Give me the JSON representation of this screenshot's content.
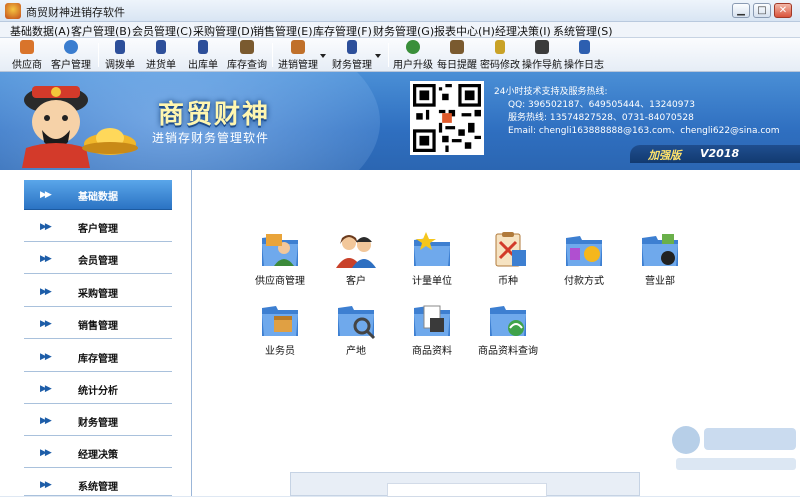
{
  "window": {
    "title": "商贸财神进销存软件",
    "minimize": "▁",
    "maximize": "□",
    "close": "✕"
  },
  "menu": [
    "基础数据(A)",
    "客户管理(B)",
    "会员管理(C)",
    "采购管理(D)",
    "销售管理(E)",
    "库存管理(F)",
    "财务管理(G)",
    "报表中心(H)",
    "经理决策(I)",
    "系统管理(S)"
  ],
  "toolbar": [
    {
      "label": "供应商",
      "icon": "supplier-icon",
      "color": "#d9742b"
    },
    {
      "label": "客户管理",
      "icon": "customer-icon",
      "color": "#3a7dcf"
    },
    {
      "label": "调拨单",
      "icon": "transfer-doc-icon",
      "color": "#2d4f9a"
    },
    {
      "label": "进货单",
      "icon": "purchase-doc-icon",
      "color": "#2d4f9a"
    },
    {
      "label": "出库单",
      "icon": "outbound-doc-icon",
      "color": "#2d4f9a"
    },
    {
      "label": "库存查询",
      "icon": "inventory-query-icon",
      "color": "#7a5a2f"
    },
    {
      "label": "进销管理",
      "icon": "sales-purchase-icon",
      "color": "#c0702a"
    },
    {
      "label": "财务管理",
      "icon": "finance-icon",
      "color": "#2d4f9a"
    },
    {
      "label": "用户升级",
      "icon": "upgrade-icon",
      "color": "#3a8f3a"
    },
    {
      "label": "每日提醒",
      "icon": "reminder-icon",
      "color": "#7a5a2f"
    },
    {
      "label": "密码修改",
      "icon": "password-icon",
      "color": "#c9a227"
    },
    {
      "label": "操作导航",
      "icon": "navigation-icon",
      "color": "#3b3b3b"
    },
    {
      "label": "操作日志",
      "icon": "log-icon",
      "color": "#2d5fb0"
    }
  ],
  "banner": {
    "brand_title": "商贸财神",
    "brand_subtitle": "进销存财务管理软件",
    "support": [
      "24小时技术支持及服务热线:",
      "QQ: 396502187、649505444、13240973",
      "服务热线: 13574827528、0731-84070528",
      "Email: chengli163888888@163.com、chengli622@sina.com"
    ],
    "edition_label": "加强版",
    "edition_version": "V2018"
  },
  "sidebar": [
    {
      "label": "基础数据",
      "active": true
    },
    {
      "label": "客户管理",
      "active": false
    },
    {
      "label": "会员管理",
      "active": false
    },
    {
      "label": "采购管理",
      "active": false
    },
    {
      "label": "销售管理",
      "active": false
    },
    {
      "label": "库存管理",
      "active": false
    },
    {
      "label": "统计分析",
      "active": false
    },
    {
      "label": "财务管理",
      "active": false
    },
    {
      "label": "经理决策",
      "active": false
    },
    {
      "label": "系统管理",
      "active": false
    }
  ],
  "modules": [
    {
      "label": "供应商管理",
      "icon": "supplier-management-icon"
    },
    {
      "label": "客户",
      "icon": "customer-icon"
    },
    {
      "label": "计量单位",
      "icon": "unit-icon"
    },
    {
      "label": "币种",
      "icon": "currency-icon"
    },
    {
      "label": "付款方式",
      "icon": "payment-method-icon"
    },
    {
      "label": "营业部",
      "icon": "branch-icon"
    },
    {
      "label": "业务员",
      "icon": "salesperson-icon"
    },
    {
      "label": "产地",
      "icon": "origin-icon"
    },
    {
      "label": "商品资料",
      "icon": "product-info-icon"
    },
    {
      "label": "商品资料查询",
      "icon": "product-query-icon"
    }
  ],
  "arrow_glyph": "▶▶"
}
